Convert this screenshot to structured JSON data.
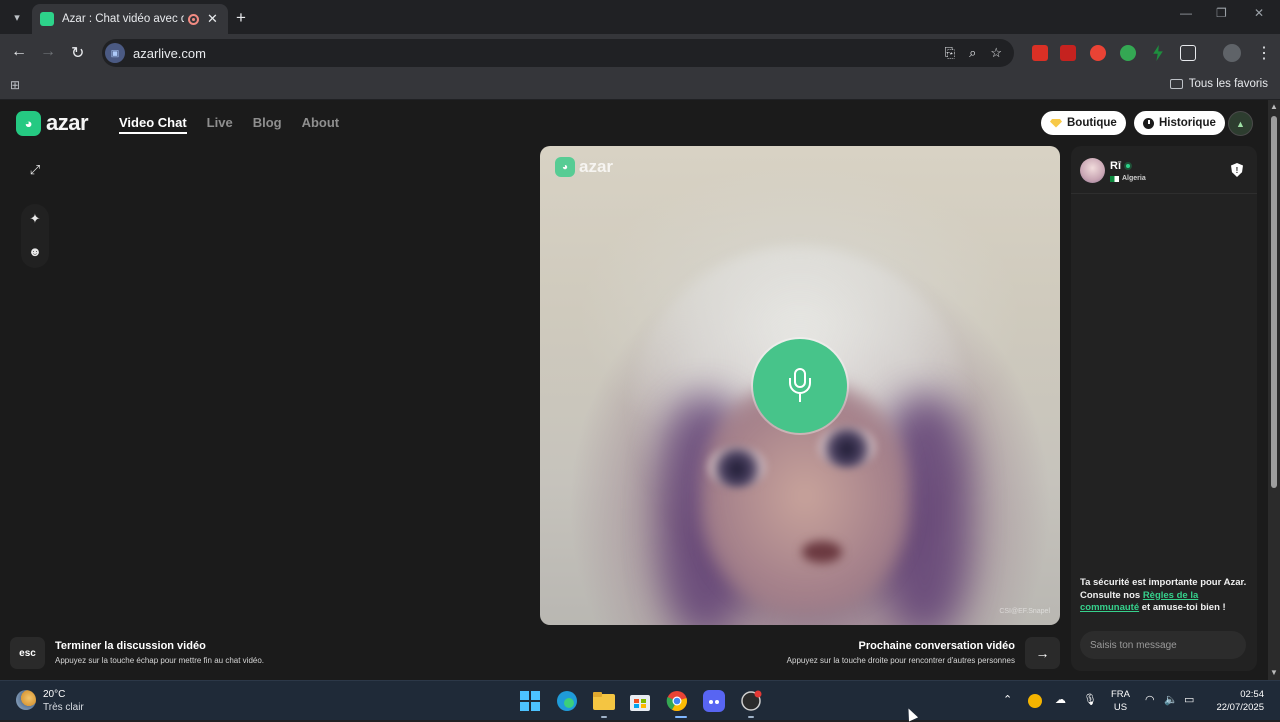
{
  "browser": {
    "tab_title": "Azar : Chat vidéo avec de n",
    "url": "azarlive.com",
    "bookmarks_label": "Tous les favoris"
  },
  "site": {
    "logo_text": "azar",
    "nav": [
      {
        "label": "Video Chat",
        "active": true
      },
      {
        "label": "Live",
        "active": false
      },
      {
        "label": "Blog",
        "active": false
      },
      {
        "label": "About",
        "active": false
      }
    ],
    "boutique_label": "Boutique",
    "historique_label": "Historique"
  },
  "video": {
    "logo_text": "azar",
    "watermark": "CSI@EF.Snapel"
  },
  "chat": {
    "peer_name": "Rī",
    "peer_country": "Algeria",
    "safety_pre": "Ta sécurité est importante pour Azar. Consulte nos ",
    "safety_link": "Règles de la communauté",
    "safety_post": " et amuse-toi bien !",
    "message_placeholder": "Saisis ton message"
  },
  "shortcuts": {
    "end_key": "esc",
    "end_title": "Terminer la discussion vidéo",
    "end_sub": "Appuyez sur la touche échap pour mettre fin au chat vidéo.",
    "next_title": "Prochaine conversation vidéo",
    "next_sub": "Appuyez sur la touche droite pour rencontrer d'autres personnes"
  },
  "taskbar": {
    "temperature": "20°C",
    "weather": "Très clair",
    "lang_top": "FRA",
    "lang_bottom": "US",
    "time": "02:54",
    "date": "22/07/2025"
  },
  "colors": {
    "accent_green": "#25c982",
    "page_bg": "#1b1b1b"
  }
}
